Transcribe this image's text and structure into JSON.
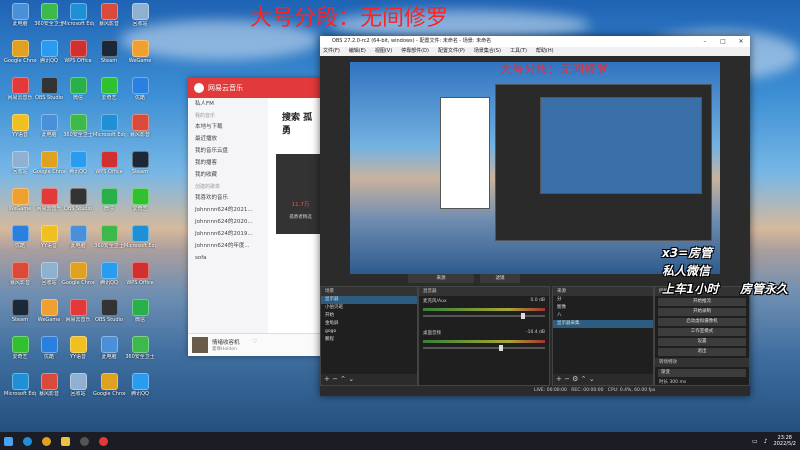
{
  "banner": {
    "main": "大号分段：无间修罗",
    "echo": "大号分段：无间修罗"
  },
  "desktop_icons": [
    {
      "label": "此电脑",
      "color": "#4a90d9"
    },
    {
      "label": "360安全卫士",
      "color": "#3cb94a"
    },
    {
      "label": "Microsoft Edge",
      "color": "#1f8fd6"
    },
    {
      "label": "暴风影音",
      "color": "#d94a3a"
    },
    {
      "label": "回收站",
      "color": "#8fb0d0"
    },
    {
      "label": "Google Chrome",
      "color": "#e0a020"
    },
    {
      "label": "腾讯QQ",
      "color": "#2a9cf0"
    },
    {
      "label": "WPS Office",
      "color": "#d03030"
    },
    {
      "label": "Steam",
      "color": "#1b2838"
    },
    {
      "label": "WeGame",
      "color": "#f0a030"
    },
    {
      "label": "网易云音乐",
      "color": "#e23a3a"
    },
    {
      "label": "OBS Studio",
      "color": "#333333"
    },
    {
      "label": "微信",
      "color": "#2ab04a"
    },
    {
      "label": "爱奇艺",
      "color": "#30c030"
    },
    {
      "label": "优酷",
      "color": "#2a80e0"
    },
    {
      "label": "YY语音",
      "color": "#f0c020"
    }
  ],
  "netease": {
    "title": "网易云音乐",
    "sidebar": {
      "fm": "私人FM",
      "section_mine": "我的音乐",
      "items": [
        "本地与下载",
        "最近播放",
        "我的音乐云盘",
        "我的播客",
        "我的收藏"
      ],
      "section_created": "创建的歌单",
      "playlists": [
        "我喜欢的音乐",
        "Johnnnn624的2021...",
        "Johnnnn624的2020...",
        "Johnnnn624的2019...",
        "Johnnnn624的年度...",
        "sofa"
      ]
    },
    "search_title": "搜索 孤勇",
    "card_count": "11.7万",
    "card_title": "孤勇者精选",
    "player": {
      "song": "情绪收容机",
      "artist": "霍尊Holden"
    }
  },
  "obs": {
    "title": "OBS 27.2.0-rc2 (64-bit, windows) - 配置文件: 未命名 - 场景: 未命名",
    "menu": [
      "文件(F)",
      "编辑(E)",
      "视图(V)",
      "停靠部件(D)",
      "配置文件(P)",
      "场景集合(S)",
      "工具(T)",
      "帮助(H)"
    ],
    "mode_source": "来源",
    "mode_filter": "滤镜",
    "docks": {
      "scenes": {
        "header": "场景",
        "items": [
          "显示器",
          "小伯贝班",
          "开始",
          "金龟屏",
          "gogo",
          "鹏程"
        ]
      },
      "sources": {
        "header": "来源",
        "items": [
          "分",
          "图像",
          "八",
          "显示器采集"
        ]
      },
      "mixer": {
        "header": "混音器",
        "channels": [
          {
            "name": "麦克风/Aux",
            "db": "0.0 dB"
          },
          {
            "name": "桌面音频",
            "db": "-10.4 dB"
          }
        ]
      },
      "transitions": {
        "header": "转场特效",
        "type": "渐变",
        "duration_label": "时长",
        "duration": "300 ms"
      },
      "controls": {
        "header": "控件",
        "buttons": [
          "开始推流",
          "开始录制",
          "启动虚拟摄像机",
          "工作室模式",
          "设置",
          "退出"
        ]
      }
    },
    "status": {
      "live": "LIVE: 00:00:00",
      "rec": "REC: 00:00:00",
      "cpu": "CPU: 0.4%, 60.00 fps"
    }
  },
  "overlay": {
    "line1": "x3=房管",
    "line2": "私人微信",
    "line3": "上车1小时",
    "line4": "房管永久"
  },
  "taskbar": {
    "time": "23:28",
    "date": "2022/5/2"
  }
}
